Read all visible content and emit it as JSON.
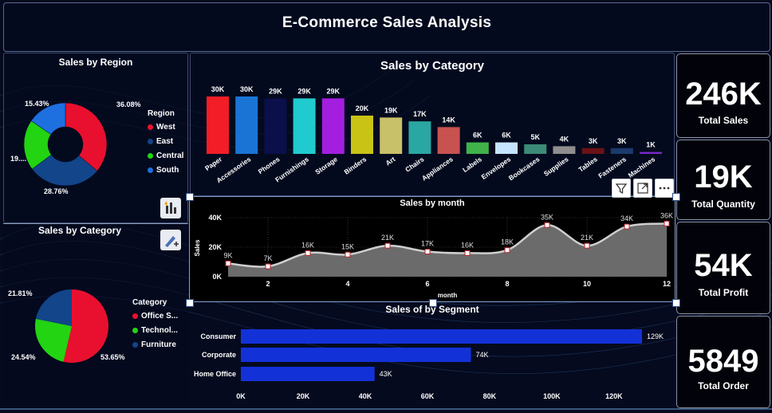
{
  "header": {
    "title": "E-Commerce Sales Analysis"
  },
  "region": {
    "title": "Sales by Region",
    "legend_title": "Region",
    "slices": [
      {
        "name": "West",
        "percent": 36.08,
        "label": "36.08%",
        "color": "#e8102e"
      },
      {
        "name": "East",
        "percent": 28.76,
        "label": "28.76%",
        "color": "#12458a"
      },
      {
        "name": "Central",
        "percent": 19.73,
        "label": "19....",
        "color": "#22d412"
      },
      {
        "name": "South",
        "percent": 15.43,
        "label": "15.43%",
        "color": "#1e6fe0"
      }
    ]
  },
  "category_pie": {
    "title": "Sales by Category",
    "legend_title": "Category",
    "slices": [
      {
        "name": "Office S...",
        "percent": 53.65,
        "label": "53.65%",
        "color": "#e8102e"
      },
      {
        "name": "Technol...",
        "percent": 24.54,
        "label": "24.54%",
        "color": "#22d412"
      },
      {
        "name": "Furniture",
        "percent": 21.81,
        "label": "21.81%",
        "color": "#12458a"
      }
    ]
  },
  "category_bar": {
    "title": "Sales by Category",
    "categories": [
      "Paper",
      "Accessories",
      "Phones",
      "Furnishings",
      "Storage",
      "Binders",
      "Art",
      "Chairs",
      "Appliances",
      "Labels",
      "Envelopes",
      "Bookcases",
      "Supplies",
      "Tables",
      "Fasteners",
      "Machines"
    ],
    "values": [
      30,
      30,
      29,
      29,
      29,
      20,
      19,
      17,
      14,
      6,
      6,
      5,
      4,
      3,
      3,
      1
    ],
    "labels": [
      "30K",
      "30K",
      "29K",
      "29K",
      "29K",
      "20K",
      "19K",
      "17K",
      "14K",
      "6K",
      "6K",
      "5K",
      "4K",
      "3K",
      "3K",
      "1K"
    ],
    "colors": [
      "#f21d26",
      "#1a74d6",
      "#0b0f4a",
      "#20cbcf",
      "#a41ee0",
      "#c9c316",
      "#c9c06a",
      "#2aa7a2",
      "#c8524f",
      "#3fb34a",
      "#c5e4ff",
      "#3c8b77",
      "#8e8e8e",
      "#6b1216",
      "#1b3a6b",
      "#7a28c8"
    ]
  },
  "month_chart": {
    "title": "Sales by month",
    "xlabel": "month",
    "ylabel": "Sales",
    "x": [
      1,
      2,
      3,
      4,
      5,
      6,
      7,
      8,
      9,
      10,
      11,
      12
    ],
    "values": [
      9,
      7,
      16,
      15,
      21,
      17,
      16,
      18,
      35,
      21,
      34,
      36
    ],
    "labels": [
      "9K",
      "7K",
      "16K",
      "15K",
      "21K",
      "17K",
      "16K",
      "18K",
      "35K",
      "21K",
      "34K",
      "36K"
    ],
    "yticks": [
      "0K",
      "20K",
      "40K"
    ],
    "xticks": [
      "2",
      "4",
      "6",
      "8",
      "10",
      "12"
    ]
  },
  "segment_chart": {
    "title": "Sales of by Segment",
    "categories": [
      "Consumer",
      "Corporate",
      "Home Office"
    ],
    "values": [
      129,
      74,
      43
    ],
    "labels": [
      "129K",
      "74K",
      "43K"
    ],
    "color": "#1232d8",
    "xticks": [
      "0K",
      "20K",
      "40K",
      "60K",
      "80K",
      "100K",
      "120K"
    ]
  },
  "kpis": [
    {
      "value": "246K",
      "label": "Total Sales"
    },
    {
      "value": "19K",
      "label": "Total Quantity"
    },
    {
      "value": "54K",
      "label": "Total Profit"
    },
    {
      "value": "5849",
      "label": "Total Order"
    }
  ],
  "icons": {
    "filter": "filter-icon",
    "focus": "focus-mode-icon",
    "more": "more-options-icon",
    "chart_type": "chart-type-icon",
    "format": "format-visual-icon"
  }
}
